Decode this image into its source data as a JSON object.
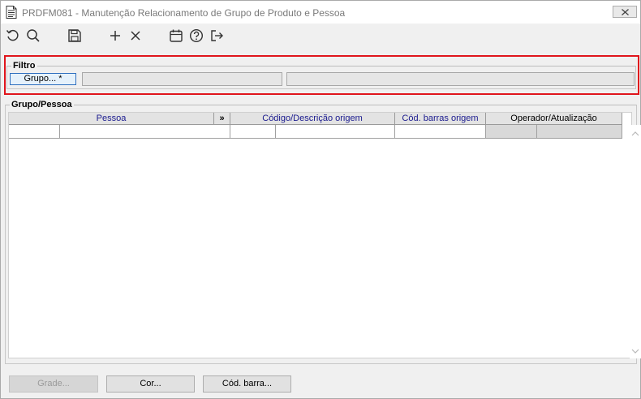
{
  "window": {
    "title": "PRDFM081 - Manutenção Relacionamento de Grupo de Produto e Pessoa"
  },
  "toolbar": {
    "icons": [
      "undo-icon",
      "search-icon",
      "save-icon",
      "add-icon",
      "delete-icon",
      "calendar-icon",
      "help-icon",
      "exit-icon"
    ]
  },
  "filtro": {
    "label": "Filtro",
    "grupo_button": "Grupo... *",
    "grupo_code": "",
    "grupo_description": ""
  },
  "grupo_pessoa": {
    "label": "Grupo/Pessoa",
    "columns": {
      "pessoa": "Pessoa",
      "expand": "»",
      "codigo_descricao": "Código/Descrição origem",
      "cod_barras": "Cód. barras origem",
      "operador": "Operador/Atualização"
    },
    "rows": [
      {
        "pessoa_code": "",
        "pessoa_name": "",
        "codigo": "",
        "descricao": "",
        "cod_barras": "",
        "operador": "",
        "atualizacao": ""
      }
    ]
  },
  "footer": {
    "grade_button": "Grade...",
    "cor_button": "Cor...",
    "cod_barra_button": "Cód. barra..."
  },
  "colors": {
    "highlight_frame": "#e0151c",
    "header_text": "#1b1b8f",
    "primary_button_border": "#2e6fbf"
  }
}
